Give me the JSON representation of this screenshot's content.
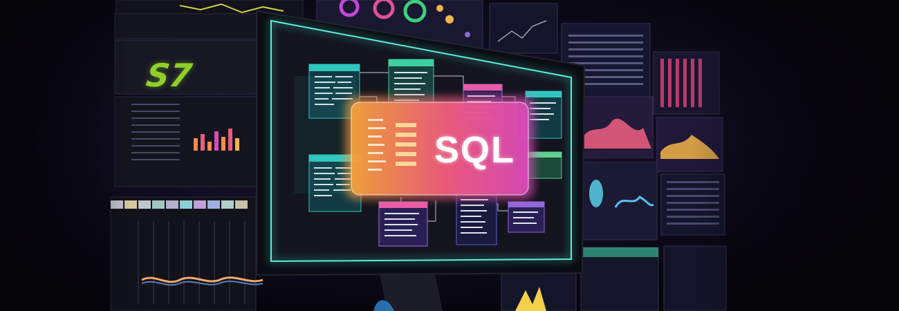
{
  "hero": {
    "center_label": "SQL",
    "background_logo": "S7"
  },
  "colors": {
    "background": "#07060d",
    "monitor_border": "#38e0c8",
    "label_gradient_start": "#f0a040",
    "label_gradient_end": "#d84ab8",
    "logo_green": "#8fcf2b"
  },
  "icons": [
    "desktop-monitor",
    "database-tables",
    "dashboard-panels"
  ]
}
